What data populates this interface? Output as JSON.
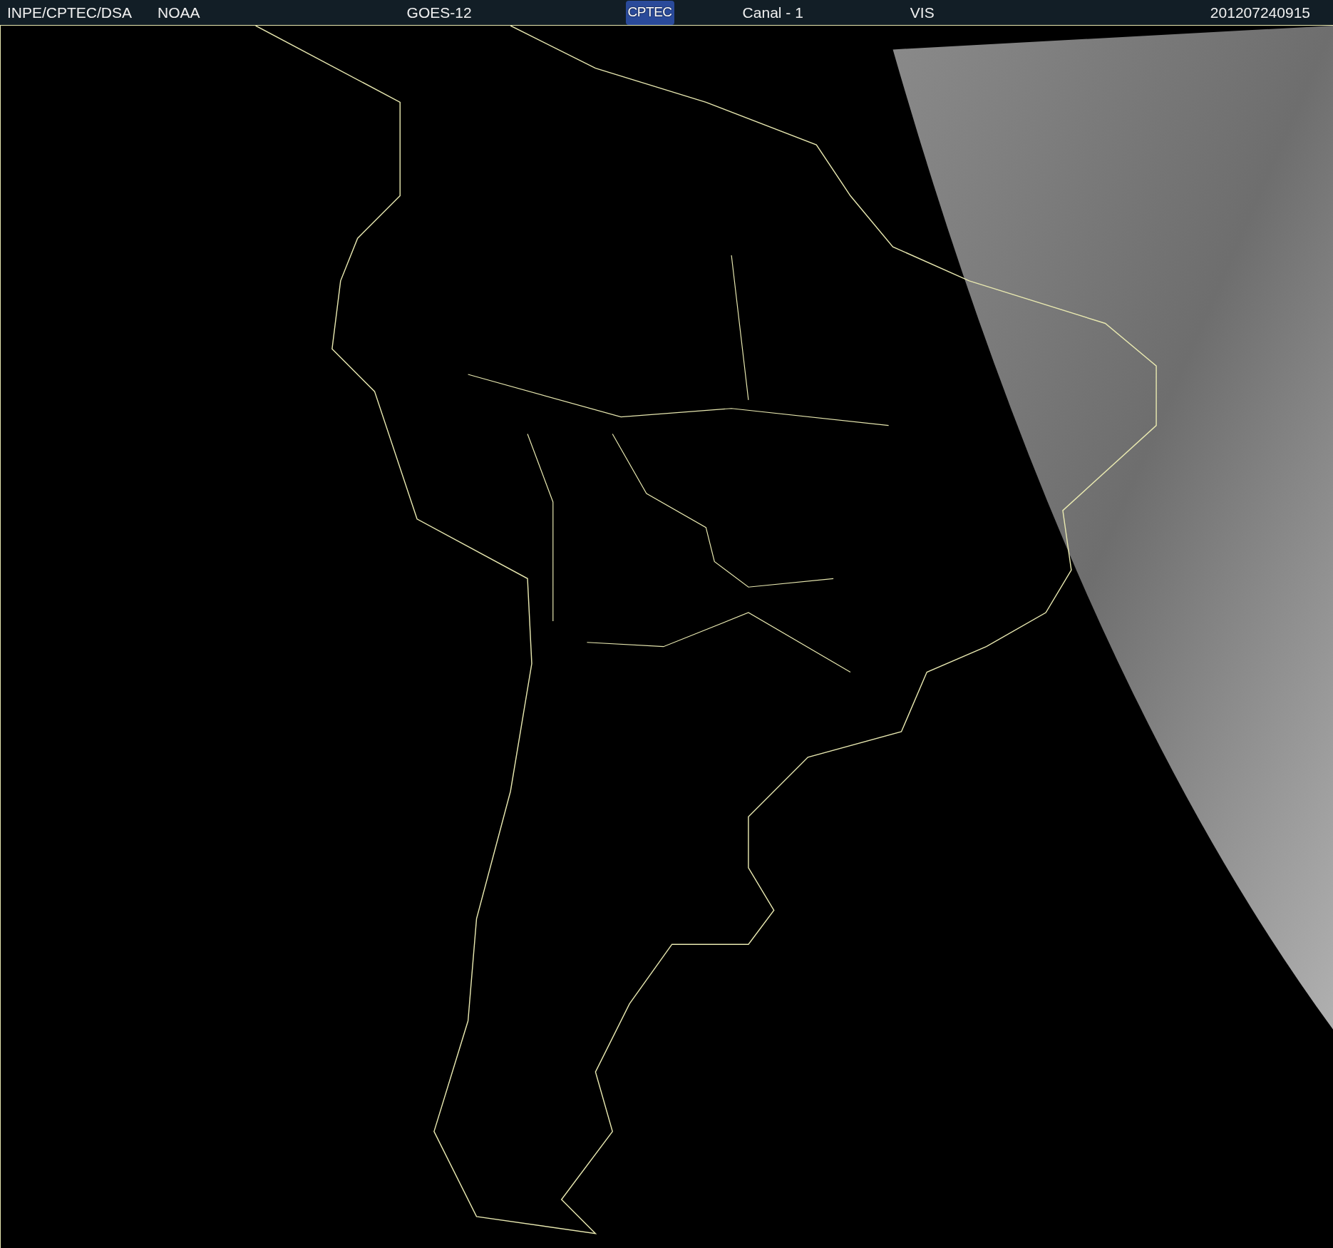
{
  "header": {
    "source": "INPE/CPTEC/DSA",
    "agency": "NOAA",
    "satellite": "GOES-12",
    "logo_text": "CPTEC",
    "channel": "Canal - 1",
    "band": "VIS",
    "timestamp": "201207240915"
  }
}
